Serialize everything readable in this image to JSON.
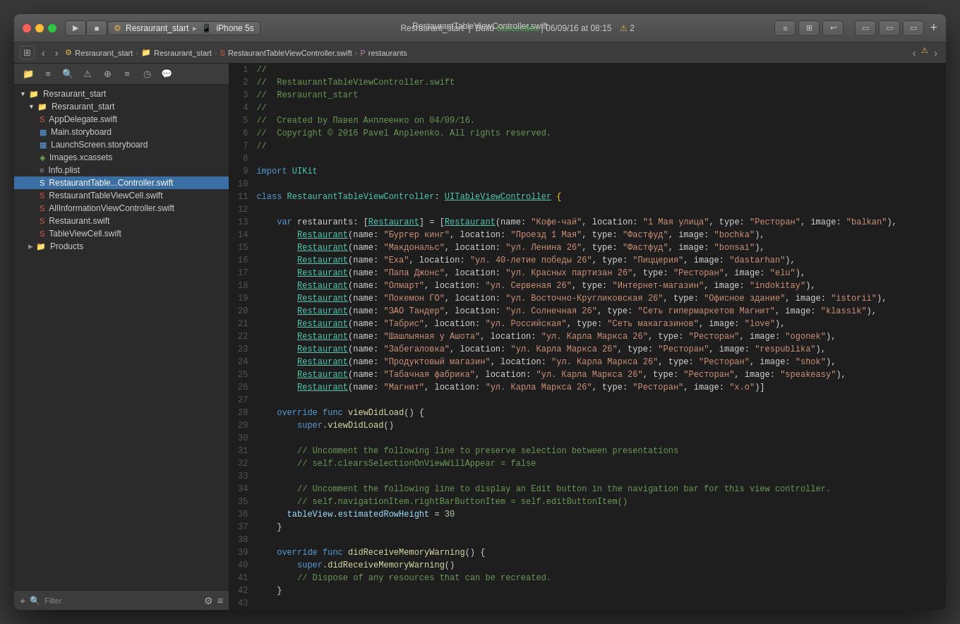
{
  "window": {
    "title": "RestaurantTableViewController.swift",
    "traffic_lights": [
      "close",
      "minimize",
      "maximize"
    ],
    "titlebar": {
      "project": "Resraurant_start",
      "device": "iPhone 5s",
      "build_label": "Resraurant_start  |  Build",
      "build_status": "Succeeded",
      "build_date": "06/09/16 at 08:15",
      "warning_count": "2",
      "add_btn": "+"
    }
  },
  "navbar": {
    "path": [
      "Resraurant_start",
      "Resraurant_start",
      "RestaurantTableViewController.swift",
      "restaurants"
    ],
    "back_btn": "<",
    "forward_btn": ">"
  },
  "sidebar": {
    "filter_label": "Filter",
    "tree": [
      {
        "id": "root",
        "label": "Resraurant_start",
        "icon": "folder",
        "indent": 0,
        "open": true
      },
      {
        "id": "group",
        "label": "Resraurant_start",
        "icon": "folder-yellow",
        "indent": 1,
        "open": true
      },
      {
        "id": "appdelegate",
        "label": "AppDelegate.swift",
        "icon": "swift",
        "indent": 2
      },
      {
        "id": "main-storyboard",
        "label": "Main.storyboard",
        "icon": "storyboard",
        "indent": 2
      },
      {
        "id": "launch-storyboard",
        "label": "LaunchScreen.storyboard",
        "icon": "storyboard",
        "indent": 2
      },
      {
        "id": "xcassets",
        "label": "Images.xcassets",
        "icon": "xcassets",
        "indent": 2
      },
      {
        "id": "plist",
        "label": "Info.plist",
        "icon": "plist",
        "indent": 2
      },
      {
        "id": "rtvc",
        "label": "RestaurantTable...Controller.swift",
        "icon": "swift",
        "indent": 2,
        "selected": true
      },
      {
        "id": "rtvCell",
        "label": "RestaurantTableViewCell.swift",
        "icon": "swift",
        "indent": 2
      },
      {
        "id": "allinfo",
        "label": "AllInformationViewController.swift",
        "icon": "swift",
        "indent": 2
      },
      {
        "id": "restaurant",
        "label": "Restaurant.swift",
        "icon": "swift",
        "indent": 2
      },
      {
        "id": "tableviewcell",
        "label": "TableViewCell.swift",
        "icon": "swift",
        "indent": 2
      },
      {
        "id": "products",
        "label": "Products",
        "icon": "folder-yellow",
        "indent": 1,
        "open": false
      }
    ]
  },
  "editor": {
    "filename": "RestaurantTableViewController.swift"
  }
}
